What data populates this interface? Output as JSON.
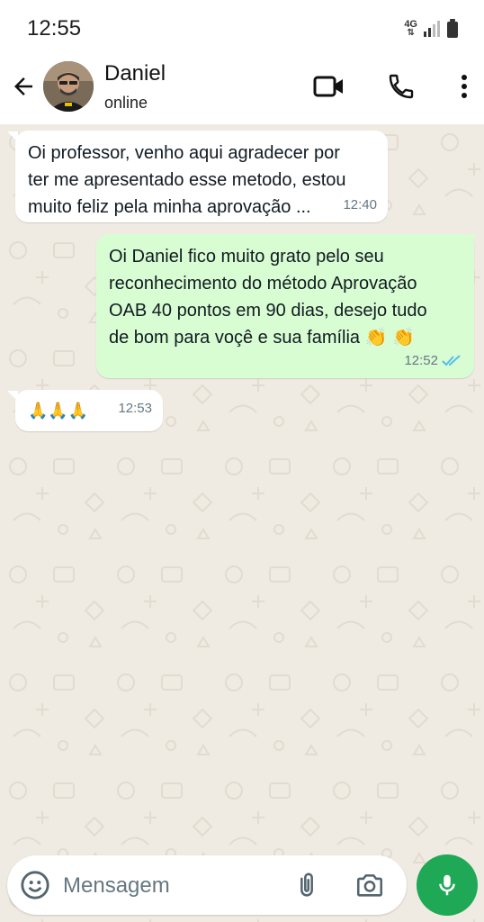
{
  "status_bar": {
    "time": "12:55",
    "network": "4G"
  },
  "header": {
    "contact_name": "Daniel",
    "contact_status": "online"
  },
  "messages": [
    {
      "direction": "incoming",
      "text": "Oi professor, venho aqui agradecer por\nter me apresentado esse metodo, estou\nmuito feliz pela minha aprovação ...",
      "time": "12:40"
    },
    {
      "direction": "outgoing",
      "text": "Oi Daniel fico muito grato pelo seu\nreconhecimento do método Aprovação\nOAB 40 pontos em 90 dias, desejo tudo\nde bom para voçê e sua família  👏 👏",
      "time": "12:52",
      "read": true
    },
    {
      "direction": "incoming",
      "text": "🙏🙏🙏",
      "time": "12:53"
    }
  ],
  "composer": {
    "placeholder": "Mensagem"
  },
  "colors": {
    "chat_bg": "#efeae2",
    "outgoing_bubble": "#d9fdd3",
    "incoming_bubble": "#ffffff",
    "accent_green": "#1fa855",
    "read_ticks": "#53bdeb"
  },
  "icons": {
    "back": "arrow-left-icon",
    "video": "video-call-icon",
    "phone": "phone-icon",
    "menu": "more-vertical-icon",
    "emoji": "emoji-icon",
    "attach": "paperclip-icon",
    "camera": "camera-icon",
    "mic": "microphone-icon"
  }
}
